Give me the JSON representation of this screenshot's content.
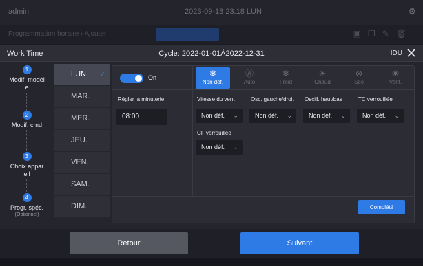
{
  "background": {
    "user": "admin",
    "datetime": "2023-09-18 23:18 LUN",
    "link": "Programmation horaire › Ajouter",
    "icons": [
      "calendar-icon",
      "copy-icon",
      "edit-icon",
      "delete-icon"
    ]
  },
  "header": {
    "title": "Work Time",
    "cycle": "Cycle: 2022-01-01À2022-12-31",
    "idu_label": "IDU"
  },
  "steps": [
    {
      "num": "1",
      "label": "Modif. modèl e",
      "sub": ""
    },
    {
      "num": "2",
      "label": "Modif. cmd",
      "sub": ""
    },
    {
      "num": "3",
      "label": "Choix appar eil",
      "sub": ""
    },
    {
      "num": "4",
      "label": "Progr. spéc.",
      "sub": "(Optionnel)"
    }
  ],
  "days": [
    "LUN.",
    "MAR.",
    "MER.",
    "JEU.",
    "VEN.",
    "SAM.",
    "DIM."
  ],
  "active_day_index": 0,
  "toggle": {
    "label": "On",
    "state": "on"
  },
  "modes": [
    {
      "label": "Non déf.",
      "icon": "❄",
      "icon_name": "snowflake-icon",
      "active": true
    },
    {
      "label": "Auto",
      "icon": "Ⓐ",
      "icon_name": "auto-icon",
      "active": false
    },
    {
      "label": "Froid",
      "icon": "❄",
      "icon_name": "cool-icon",
      "active": false
    },
    {
      "label": "Chaud",
      "icon": "☀",
      "icon_name": "sun-icon",
      "active": false
    },
    {
      "label": "Sec",
      "icon": "⊗",
      "icon_name": "dry-icon",
      "active": false
    },
    {
      "label": "Vent.",
      "icon": "❀",
      "icon_name": "fan-icon",
      "active": false
    }
  ],
  "timer": {
    "label": "Régler la minuterie",
    "value": "08:00"
  },
  "fields": [
    {
      "label": "Vitesse du vent",
      "value": "Non déf."
    },
    {
      "label": "Osc. gauche/droit",
      "value": "Non déf."
    },
    {
      "label": "Oscill. haut/bas",
      "value": "Non déf."
    },
    {
      "label": "TC verrouillée",
      "value": "Non déf."
    },
    {
      "label": "CF verrouillée",
      "value": "Non déf."
    }
  ],
  "buttons": {
    "complete": "Complété",
    "back": "Retour",
    "next": "Suivant"
  },
  "colors": {
    "accent": "#2f7be6",
    "background": "#25262d",
    "panel": "#2b2c34",
    "field": "#1d1e24",
    "back_button": "#555761"
  }
}
